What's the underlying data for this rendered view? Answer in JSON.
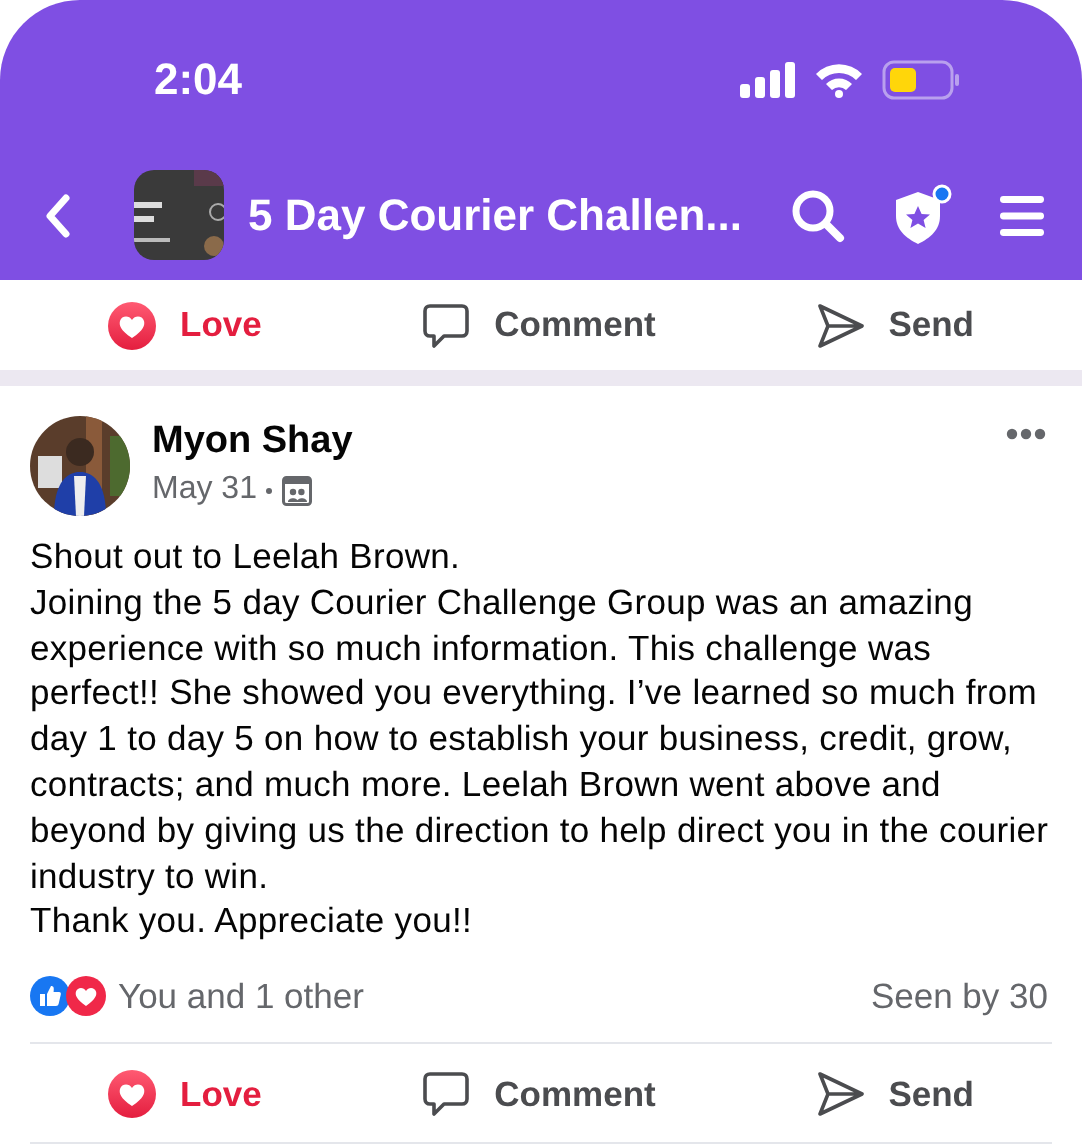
{
  "status_bar": {
    "time": "2:04"
  },
  "header": {
    "title": "5 Day Courier Challen...",
    "shield_notification": true
  },
  "top_actions": [
    {
      "kind": "love",
      "label": "Love",
      "active": true
    },
    {
      "kind": "comment",
      "label": "Comment",
      "active": false
    },
    {
      "kind": "send",
      "label": "Send",
      "active": false
    }
  ],
  "post": {
    "author": "Myon Shay",
    "date": "May 31",
    "paragraphs": [
      "Shout out to Leelah Brown.",
      "Joining the 5 day Courier Challenge Group was an amazing experience with so much information. This challenge was perfect!! She showed you everything. I’ve learned so much from day 1 to day 5 on how to establish your business, credit, grow, contracts; and much more. Leelah Brown went above and beyond by giving us the direction to help direct you in the courier industry to win.",
      "Thank you. Appreciate you!!"
    ],
    "reactions_summary": "You and 1 other",
    "seen": "Seen by 30",
    "actions": [
      {
        "kind": "love",
        "label": "Love",
        "active": true
      },
      {
        "kind": "comment",
        "label": "Comment",
        "active": false
      },
      {
        "kind": "send",
        "label": "Send",
        "active": false
      }
    ]
  }
}
